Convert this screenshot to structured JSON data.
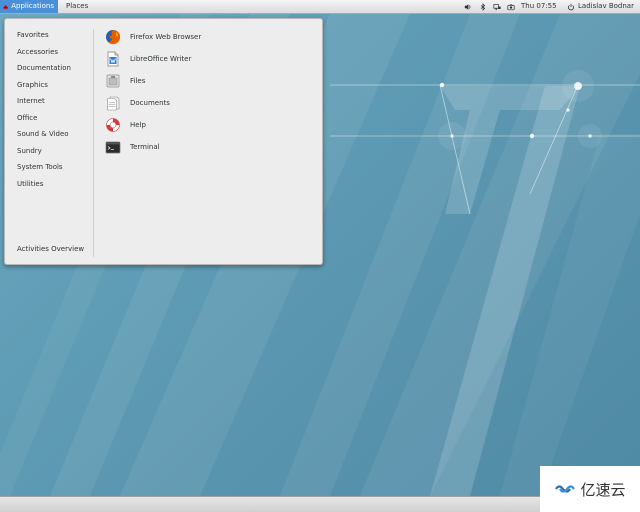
{
  "topbar": {
    "applications_label": "Applications",
    "places_label": "Places",
    "clock": "Thu 07:55",
    "user_name": "Ladislav Bodnar",
    "tray_icons": [
      "volume-icon",
      "bluetooth-icon",
      "network-icon",
      "camera-icon"
    ]
  },
  "menu": {
    "categories": [
      "Favorites",
      "Accessories",
      "Documentation",
      "Graphics",
      "Internet",
      "Office",
      "Sound & Video",
      "Sundry",
      "System Tools",
      "Utilities"
    ],
    "activities_overview": "Activities Overview",
    "apps": [
      {
        "label": "Firefox Web Browser",
        "icon": "firefox-icon"
      },
      {
        "label": "LibreOffice Writer",
        "icon": "libreoffice-writer-icon"
      },
      {
        "label": "Files",
        "icon": "files-icon"
      },
      {
        "label": "Documents",
        "icon": "documents-icon"
      },
      {
        "label": "Help",
        "icon": "help-icon"
      },
      {
        "label": "Terminal",
        "icon": "terminal-icon"
      }
    ]
  },
  "watermark": {
    "text": "亿速云"
  },
  "colors": {
    "accent": "#4a90d9",
    "desktop": "#5e9ab2",
    "menu_bg": "#ededed"
  }
}
